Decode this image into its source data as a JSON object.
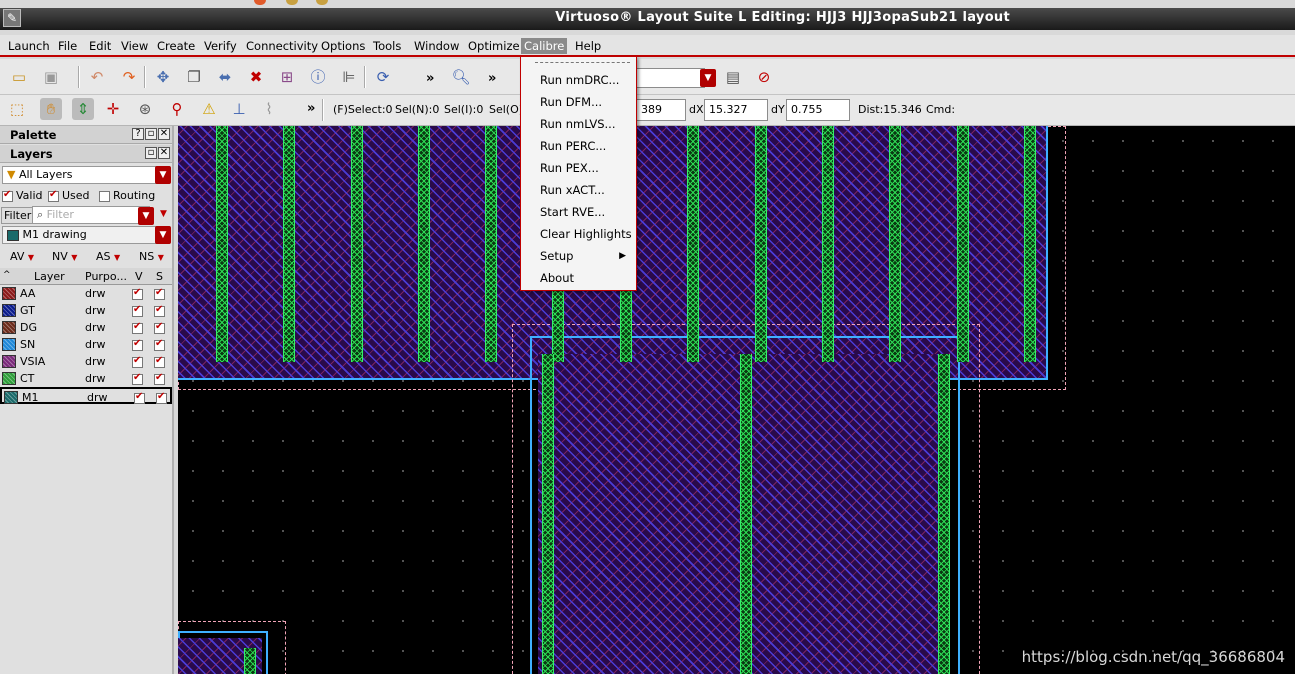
{
  "window": {
    "title": "Virtuoso® Layout Suite L Editing: HJJ3 HJJ3opaSub21 layout"
  },
  "menubar": {
    "items": [
      {
        "label": "Launch"
      },
      {
        "label": "File"
      },
      {
        "label": "Edit"
      },
      {
        "label": "View"
      },
      {
        "label": "Create"
      },
      {
        "label": "Verify"
      },
      {
        "label": "Connectivity"
      },
      {
        "label": "Options"
      },
      {
        "label": "Tools"
      },
      {
        "label": "Window"
      },
      {
        "label": "Optimize"
      },
      {
        "label": "Calibre"
      },
      {
        "label": "Help"
      }
    ],
    "active": "Calibre"
  },
  "calibre_menu": {
    "items": [
      "Run nmDRC...",
      "Run DFM...",
      "Run nmLVS...",
      "Run PERC...",
      "Run PEX...",
      "Run xACT...",
      "Start RVE...",
      "Clear Highlights",
      "Setup",
      "About"
    ]
  },
  "status": {
    "fselect": "(F)Select:0",
    "seln": "Sel(N):0",
    "seli": "Sel(I):0",
    "selo": "Sel(O)",
    "x_value": "389",
    "dx_label": "dX",
    "dx_value": "15.327",
    "dy_label": "dY",
    "dy_value": "0.755",
    "dist": "Dist:15.346",
    "cmd": "Cmd:"
  },
  "palette": {
    "title": "Palette",
    "layers_title": "Layers",
    "filter_set": "All Layers",
    "valid_label": "Valid",
    "used_label": "Used",
    "routing_label": "Routing",
    "valid_checked": true,
    "used_checked": true,
    "routing_checked": false,
    "filter_button": "Filter",
    "filter_placeholder": "Filter",
    "current_layer": "M1 drawing",
    "visibility_buttons": [
      "AV",
      "NV",
      "AS",
      "NS"
    ],
    "columns": [
      "Layer",
      "Purpo...",
      "V",
      "S"
    ],
    "layers": [
      {
        "name": "AA",
        "purpose": "drw",
        "color": "#8b1a1a"
      },
      {
        "name": "GT",
        "purpose": "drw",
        "color": "#0b1c8c"
      },
      {
        "name": "DG",
        "purpose": "drw",
        "color": "#6b2a1a"
      },
      {
        "name": "SN",
        "purpose": "drw",
        "color": "#1e88d8"
      },
      {
        "name": "VSIA",
        "purpose": "drw",
        "color": "#7a2a7a"
      },
      {
        "name": "CT",
        "purpose": "drw",
        "color": "#2e9e3a"
      },
      {
        "name": "M1",
        "purpose": "drw",
        "color": "#1a6a6a"
      }
    ],
    "selected_layer": "M1"
  },
  "watermark": "https://blog.csdn.net/qq_36686804",
  "colors": {
    "accent": "#c00000",
    "metal": "#4a3cd6",
    "contact": "#2edc55",
    "outline": "#3fb0ff"
  }
}
